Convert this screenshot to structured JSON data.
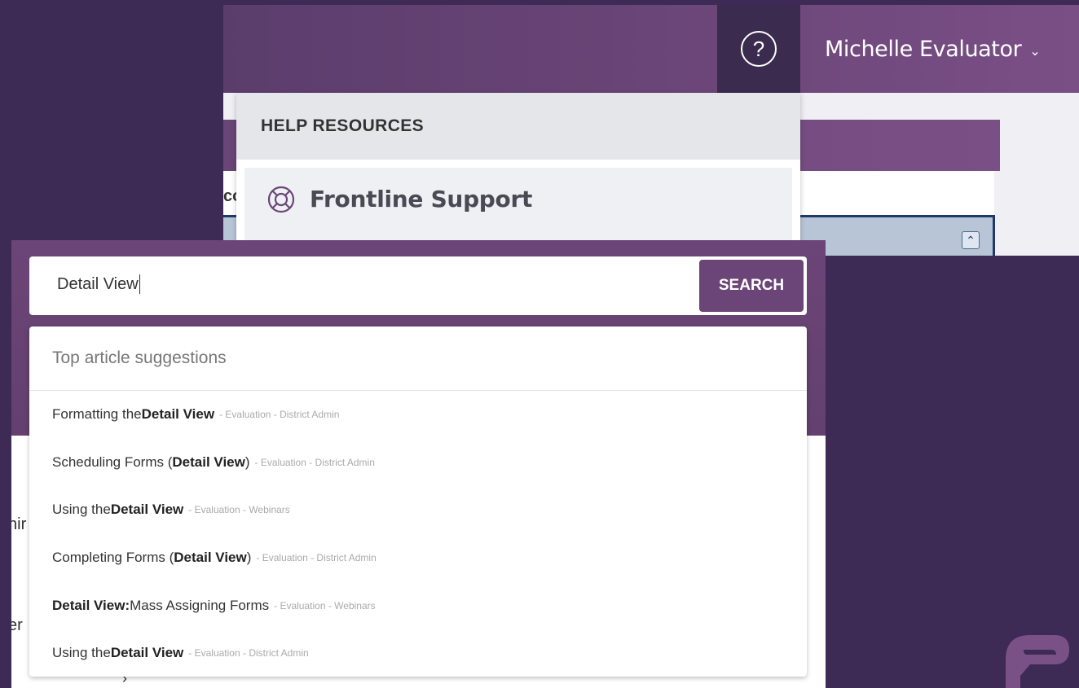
{
  "header": {
    "user_name": "Michelle Evaluator",
    "help_icon": "question-circle-icon",
    "dropdown_icon": "chevron-down-icon",
    "partial_text": "co"
  },
  "help_menu": {
    "title": "HELP RESOURCES",
    "items": [
      {
        "label": "Frontline Support",
        "icon": "lifebuoy-icon"
      }
    ]
  },
  "search": {
    "value": "Detail View",
    "button_label": "SEARCH",
    "suggestions_title": "Top article suggestions",
    "suggestions": [
      {
        "pre": "Formatting the ",
        "bold": "Detail View",
        "post": "",
        "meta": "- Evaluation - District Admin"
      },
      {
        "pre": "Scheduling Forms (",
        "bold": "Detail View",
        "post": ")",
        "meta": "- Evaluation - District Admin"
      },
      {
        "pre": "Using the ",
        "bold": "Detail View",
        "post": "",
        "meta": "- Evaluation - Webinars"
      },
      {
        "pre": "Completing Forms (",
        "bold": "Detail View",
        "post": ")",
        "meta": "- Evaluation - District Admin"
      },
      {
        "pre": "",
        "bold": "Detail View:",
        "post": " Mass Assigning Forms",
        "meta": "- Evaluation - Webinars"
      },
      {
        "pre": "Using the ",
        "bold": "Detail View",
        "post": "",
        "meta": "- Evaluation - District Admin"
      }
    ]
  },
  "partial_side_text": [
    "hir",
    "er"
  ],
  "colors": {
    "background": "#3d2a55",
    "brand_purple": "#6b4577",
    "help_button": "#3b2c4f"
  }
}
